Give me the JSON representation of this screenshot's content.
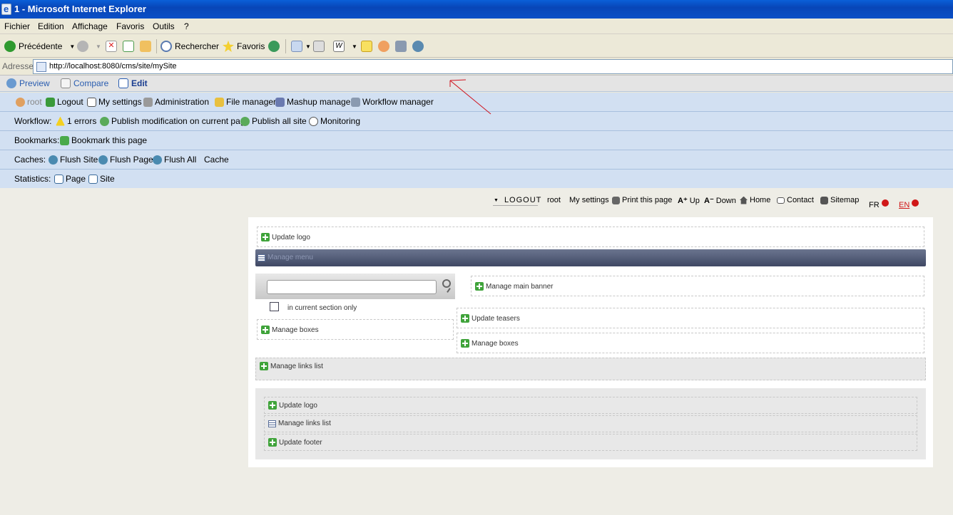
{
  "window": {
    "title": "1 - Microsoft Internet Explorer"
  },
  "menubar": [
    "Fichier",
    "Edition",
    "Affichage",
    "Favoris",
    "Outils",
    "?"
  ],
  "toolbar": {
    "back": "Précédente",
    "search": "Rechercher",
    "favorites": "Favoris"
  },
  "address": {
    "label": "Adresse",
    "url": "http://localhost:8080/cms/site/mySite"
  },
  "cms": {
    "tabs": {
      "preview": "Preview",
      "compare": "Compare",
      "edit": "Edit"
    },
    "user_row": {
      "user": "root",
      "logout": "Logout",
      "settings": "My settings",
      "admin": "Administration",
      "file_manager": "File manager",
      "mashup_manager": "Mashup manager",
      "workflow_manager": "Workflow manager"
    },
    "workflow": {
      "label": "Workflow:",
      "errors": "1 errors",
      "publish_page": "Publish modification on current page",
      "publish_site": "Publish all site",
      "monitoring": "Monitoring"
    },
    "bookmarks": {
      "label": "Bookmarks:",
      "bookmark_page": "Bookmark this page"
    },
    "caches": {
      "label": "Caches:",
      "flush_site": "Flush Site",
      "flush_page": "Flush Page",
      "flush_all": "Flush All",
      "cache": "Cache"
    },
    "statistics": {
      "label": "Statistics:",
      "page": "Page",
      "site": "Site"
    }
  },
  "site": {
    "topnav": {
      "logout": "LOGOUT",
      "user": "root",
      "settings": "My settings",
      "print": "Print this page",
      "up": "Up",
      "down": "Down",
      "home": "Home",
      "contact": "Contact",
      "sitemap": "Sitemap",
      "lang_fr": "FR",
      "lang_en": "EN"
    },
    "update_logo": "Update logo",
    "manage_menu": "Manage menu",
    "manage_main_banner": "Manage main banner",
    "search_scope": "in current section only",
    "update_teasers": "Update teasers",
    "manage_boxes_left": "Manage boxes",
    "manage_boxes_right": "Manage boxes",
    "manage_links_list": "Manage links list",
    "footer": {
      "update_logo": "Update logo",
      "manage_links_list": "Manage links list",
      "update_footer": "Update footer"
    }
  },
  "colors": {
    "titlebar": "#0a4fc6",
    "cms_row_bg": "#d2e0f2",
    "add_icon": "#3fa33a",
    "menu_bar": "#4a536e",
    "annotation": "#d0141e"
  }
}
